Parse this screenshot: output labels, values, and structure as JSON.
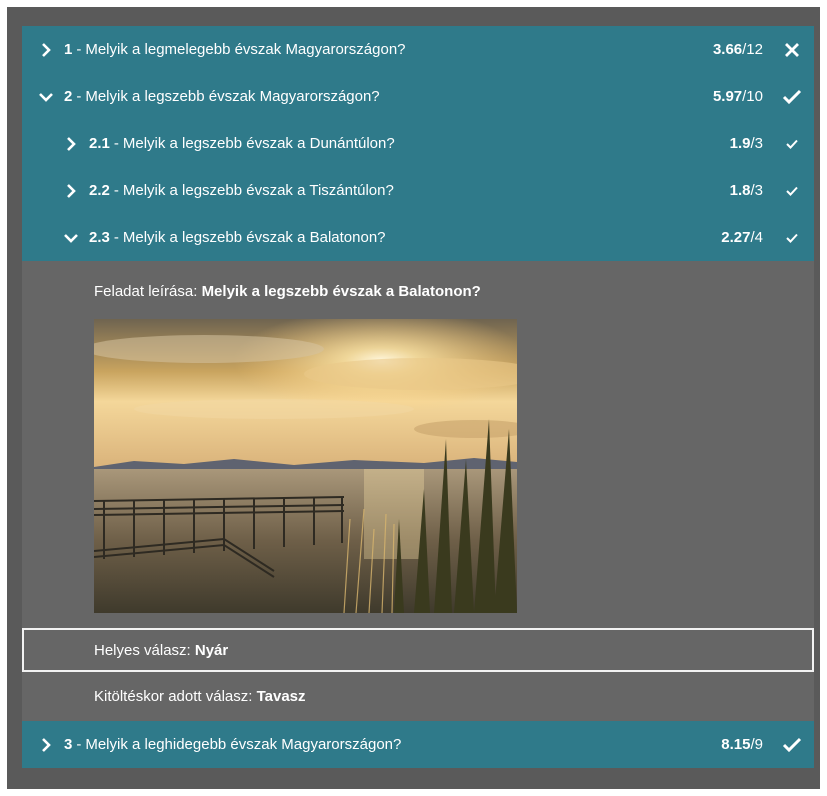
{
  "questions": [
    {
      "num": "1",
      "text": "Melyik a legmelegebb évszak Magyarországon?",
      "score": "3.66",
      "max": "/12",
      "icon": "x-icon",
      "expanded": false
    },
    {
      "num": "2",
      "text": "Melyik a legszebb évszak Magyarországon?",
      "score": "5.97",
      "max": "/10",
      "icon": "check-icon",
      "expanded": true,
      "sub": [
        {
          "num": "2.1",
          "text": "Melyik a legszebb évszak a Dunántúlon?",
          "score": "1.9",
          "max": "/3",
          "icon": "check-icon"
        },
        {
          "num": "2.2",
          "text": "Melyik a legszebb évszak a Tiszántúlon?",
          "score": "1.8",
          "max": "/3",
          "icon": "check-icon"
        },
        {
          "num": "2.3",
          "text": "Melyik a legszebb évszak a Balatonon?",
          "score": "2.27",
          "max": "/4",
          "icon": "check-icon",
          "expanded": true
        }
      ]
    },
    {
      "num": "3",
      "text": "Melyik a leghidegebb évszak Magyarországon?",
      "score": "8.15",
      "max": "/9",
      "icon": "check-icon",
      "expanded": false
    }
  ],
  "separator": "-",
  "detail": {
    "desc_label": "Feladat leírása:",
    "desc_value": "Melyik a legszebb évszak a Balatonon?",
    "correct_label": "Helyes válasz:",
    "correct_value": "Nyár",
    "given_label": "Kitöltéskor adott válasz:",
    "given_value": "Tavasz"
  },
  "colors": {
    "row_bg": "#2f7a8a",
    "panel_bg": "#666666",
    "frame_bg": "#5a5a5a"
  }
}
